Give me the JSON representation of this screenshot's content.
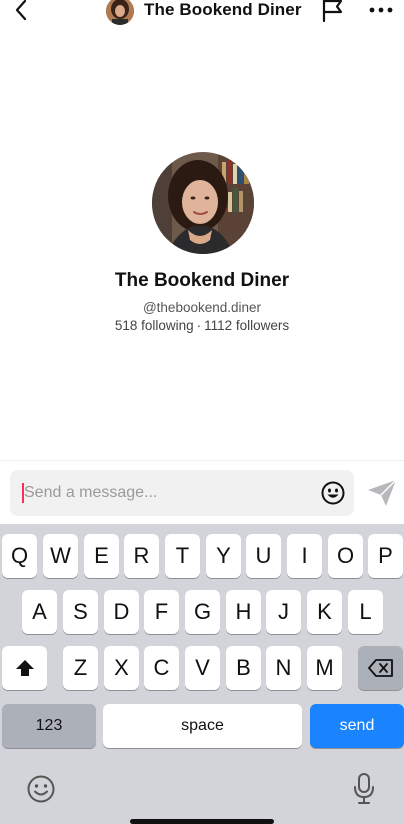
{
  "header": {
    "title": "The Bookend Diner",
    "icons": [
      "back-chevron-icon",
      "flag-icon",
      "more-dots-icon"
    ]
  },
  "profile": {
    "name": "The Bookend Diner",
    "handle": "@thebookend.diner",
    "following": "518 following",
    "separator": "·",
    "followers": "1112 followers"
  },
  "composer": {
    "placeholder": "Send a message...",
    "value": ""
  },
  "keyboard": {
    "row1": [
      "Q",
      "W",
      "E",
      "R",
      "T",
      "Y",
      "U",
      "I",
      "O",
      "P"
    ],
    "row2": [
      "A",
      "S",
      "D",
      "F",
      "G",
      "H",
      "J",
      "K",
      "L"
    ],
    "row3": [
      "Z",
      "X",
      "C",
      "V",
      "B",
      "N",
      "M"
    ],
    "numbers_label": "123",
    "space_label": "space",
    "send_label": "send"
  },
  "colors": {
    "accent_send": "#1a84ff",
    "cursor": "#ff2c55",
    "keyboard_bg": "#d2d4da"
  }
}
